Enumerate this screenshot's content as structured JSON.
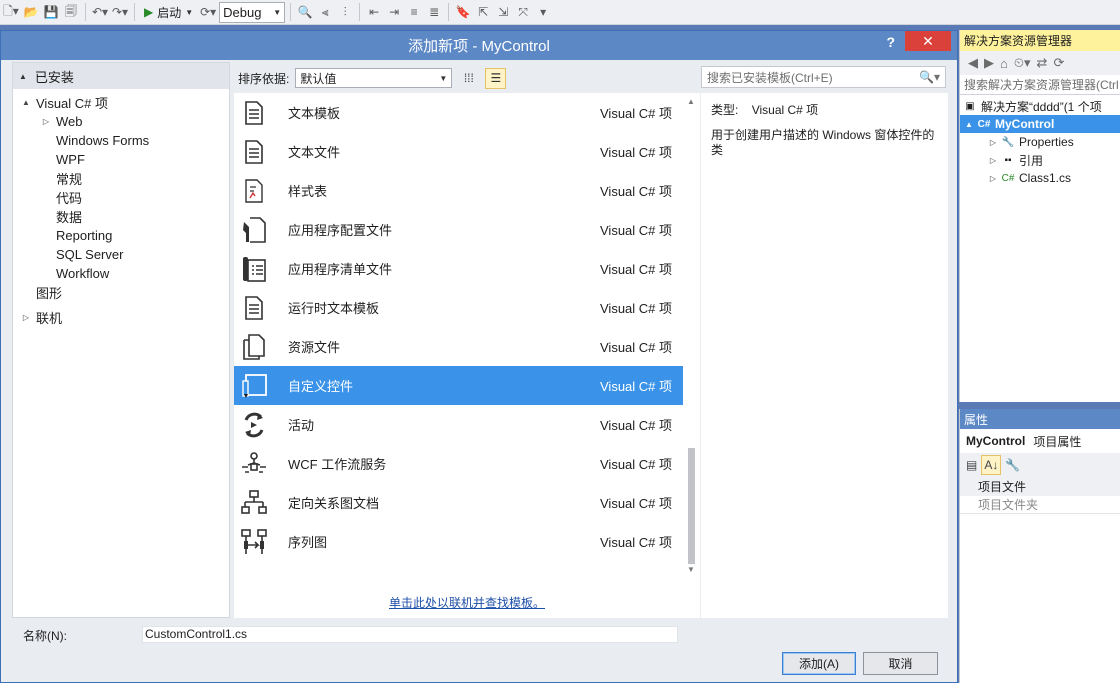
{
  "toolbar": {
    "start_label": "启动",
    "config_value": "Debug"
  },
  "dialog": {
    "title": "添加新项 - MyControl",
    "help": "?",
    "close": "✕"
  },
  "tree": {
    "header": "已安装",
    "items": [
      {
        "label": "Visual C# 项",
        "level": 0,
        "expand": "▲"
      },
      {
        "label": "Web",
        "level": 1,
        "expand": "▷"
      },
      {
        "label": "Windows Forms",
        "level": 1,
        "expand": ""
      },
      {
        "label": "WPF",
        "level": 1,
        "expand": ""
      },
      {
        "label": "常规",
        "level": 1,
        "expand": ""
      },
      {
        "label": "代码",
        "level": 1,
        "expand": ""
      },
      {
        "label": "数据",
        "level": 1,
        "expand": ""
      },
      {
        "label": "Reporting",
        "level": 1,
        "expand": ""
      },
      {
        "label": "SQL Server",
        "level": 1,
        "expand": ""
      },
      {
        "label": "Workflow",
        "level": 1,
        "expand": ""
      },
      {
        "label": "图形",
        "level": 0,
        "expand": ""
      }
    ],
    "online": "联机"
  },
  "sort": {
    "label": "排序依据:",
    "value": "默认值"
  },
  "search": {
    "placeholder": "搜索已安装模板(Ctrl+E)"
  },
  "templates": [
    {
      "name": "文本模板",
      "type": "Visual C# 项",
      "icon": "document-icon"
    },
    {
      "name": "文本文件",
      "type": "Visual C# 项",
      "icon": "text-file-icon"
    },
    {
      "name": "样式表",
      "type": "Visual C# 项",
      "icon": "stylesheet-icon"
    },
    {
      "name": "应用程序配置文件",
      "type": "Visual C# 项",
      "icon": "config-file-icon"
    },
    {
      "name": "应用程序清单文件",
      "type": "Visual C# 项",
      "icon": "manifest-file-icon"
    },
    {
      "name": "运行时文本模板",
      "type": "Visual C# 项",
      "icon": "runtime-template-icon"
    },
    {
      "name": "资源文件",
      "type": "Visual C# 项",
      "icon": "resource-file-icon"
    },
    {
      "name": "自定义控件",
      "type": "Visual C# 项",
      "icon": "custom-control-icon",
      "selected": true
    },
    {
      "name": "活动",
      "type": "Visual C# 项",
      "icon": "activity-icon"
    },
    {
      "name": "WCF 工作流服务",
      "type": "Visual C# 项",
      "icon": "wcf-workflow-icon"
    },
    {
      "name": "定向关系图文档",
      "type": "Visual C# 项",
      "icon": "directed-graph-icon"
    },
    {
      "name": "序列图",
      "type": "Visual C# 项",
      "icon": "sequence-diagram-icon"
    }
  ],
  "online_link": "单击此处以联机并查找模板。",
  "detail": {
    "type_label": "类型:",
    "type_value": "Visual C# 项",
    "description": "用于创建用户描述的 Windows 窗体控件的类"
  },
  "name_field": {
    "label": "名称(N):",
    "value": "CustomControl1.cs"
  },
  "buttons": {
    "add": "添加(A)",
    "cancel": "取消"
  },
  "solution_explorer": {
    "title": "解决方案资源管理器",
    "search_placeholder": "搜索解决方案资源管理器(Ctrl",
    "solution": "解决方案“dddd”(1 个项",
    "project": "MyControl",
    "children": [
      "Properties",
      "引用",
      "Class1.cs"
    ]
  },
  "properties": {
    "title": "属性",
    "object": "MyControl",
    "object_kind": "项目属性",
    "category": "项目文件",
    "field": "项目文件夹"
  }
}
